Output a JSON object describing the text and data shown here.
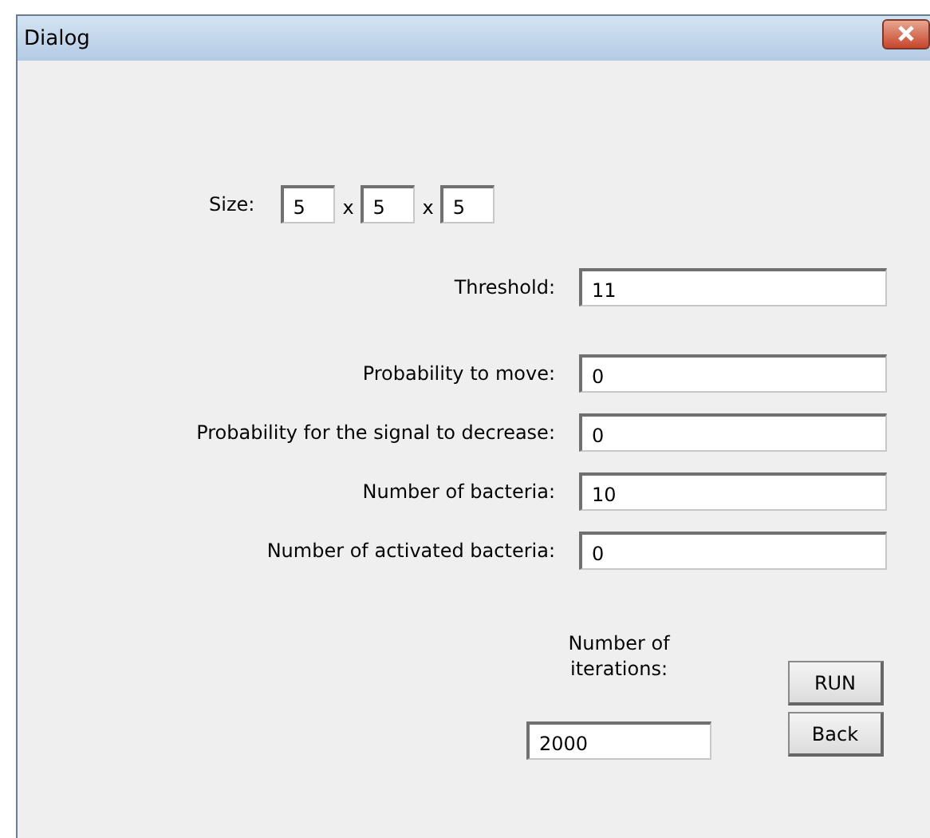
{
  "window": {
    "title": "Dialog"
  },
  "size": {
    "label": "Size:",
    "separators": [
      "x",
      "x"
    ],
    "values": [
      "5",
      "5",
      "5"
    ]
  },
  "parameters": [
    {
      "label": "Threshold:",
      "value": "11"
    },
    {
      "label": "Probability to move:",
      "value": "0"
    },
    {
      "label": "Probability for the signal to decrease:",
      "value": "0"
    },
    {
      "label": "Number of bacteria:",
      "value": "10"
    },
    {
      "label": "Number of activated bacteria:",
      "value": "0"
    }
  ],
  "iterations": {
    "label": "Number of iterations:",
    "value": "2000"
  },
  "buttons": [
    "RUN",
    "Back"
  ]
}
